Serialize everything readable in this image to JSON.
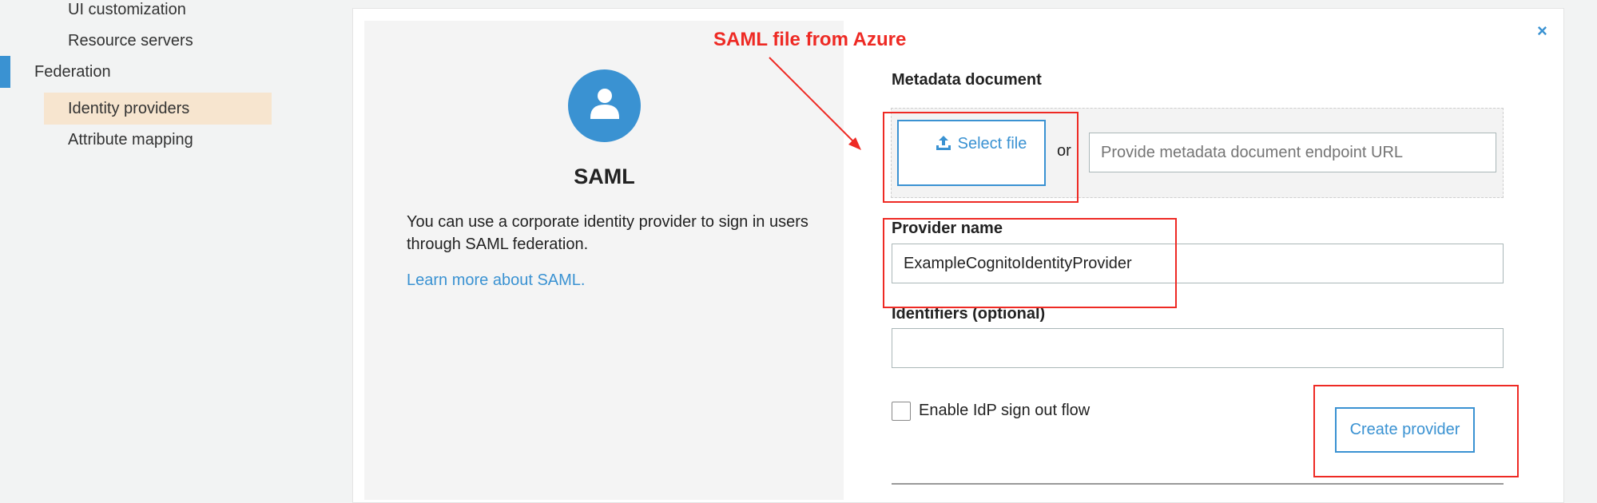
{
  "sidebar": {
    "items": [
      {
        "label": "UI customization"
      },
      {
        "label": "Resource servers"
      },
      {
        "label": "Federation"
      },
      {
        "label": "Identity providers"
      },
      {
        "label": "Attribute mapping"
      }
    ]
  },
  "modal": {
    "close_label": "×",
    "saml": {
      "title": "SAML",
      "description": "You can use a corporate identity provider to sign in users through SAML federation.",
      "learn_more": "Learn more about SAML."
    },
    "metadata": {
      "label": "Metadata document",
      "select_file": "Select file",
      "or": "or",
      "url_placeholder": "Provide metadata document endpoint URL"
    },
    "provider_name": {
      "label": "Provider name",
      "value": "ExampleCognitoIdentityProvider"
    },
    "identifiers": {
      "label": "Identifiers (optional)",
      "value": ""
    },
    "idp_signout": {
      "label": "Enable IdP sign out flow",
      "checked": false
    },
    "create_button": "Create provider"
  },
  "annotation": {
    "text": "SAML file from Azure",
    "color": "#ee2a24"
  },
  "colors": {
    "accent": "#3a92d2",
    "selected_bg": "#f7e5cf"
  }
}
